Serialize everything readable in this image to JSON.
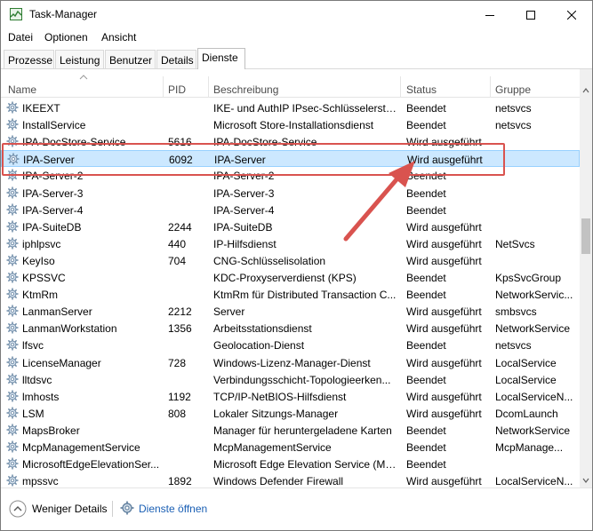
{
  "window": {
    "title": "Task-Manager"
  },
  "menu": [
    "Datei",
    "Optionen",
    "Ansicht"
  ],
  "tabs": [
    "Prozesse",
    "Leistung",
    "Benutzer",
    "Details",
    "Dienste"
  ],
  "active_tab": "Dienste",
  "columns": {
    "name": "Name",
    "pid": "PID",
    "description": "Beschreibung",
    "status": "Status",
    "group": "Gruppe"
  },
  "rows": [
    {
      "name": "IKEEXT",
      "pid": "",
      "description": "IKE- und AuthIP IPsec-Schlüsselerste...",
      "status": "Beendet",
      "group": "netsvcs"
    },
    {
      "name": "InstallService",
      "pid": "",
      "description": "Microsoft Store-Installationsdienst",
      "status": "Beendet",
      "group": "netsvcs"
    },
    {
      "name": "IPA-DocStore-Service",
      "pid": "5616",
      "description": "IPA-DocStore-Service",
      "status": "Wird ausgeführt",
      "group": ""
    },
    {
      "name": "IPA-Server",
      "pid": "6092",
      "description": "IPA-Server",
      "status": "Wird ausgeführt",
      "group": "",
      "selected": true
    },
    {
      "name": "IPA-Server-2",
      "pid": "",
      "description": "IPA-Server-2",
      "status": "Beendet",
      "group": ""
    },
    {
      "name": "IPA-Server-3",
      "pid": "",
      "description": "IPA-Server-3",
      "status": "Beendet",
      "group": ""
    },
    {
      "name": "IPA-Server-4",
      "pid": "",
      "description": "IPA-Server-4",
      "status": "Beendet",
      "group": ""
    },
    {
      "name": "IPA-SuiteDB",
      "pid": "2244",
      "description": "IPA-SuiteDB",
      "status": "Wird ausgeführt",
      "group": ""
    },
    {
      "name": "iphlpsvc",
      "pid": "440",
      "description": "IP-Hilfsdienst",
      "status": "Wird ausgeführt",
      "group": "NetSvcs"
    },
    {
      "name": "KeyIso",
      "pid": "704",
      "description": "CNG-Schlüsselisolation",
      "status": "Wird ausgeführt",
      "group": ""
    },
    {
      "name": "KPSSVC",
      "pid": "",
      "description": "KDC-Proxyserverdienst (KPS)",
      "status": "Beendet",
      "group": "KpsSvcGroup"
    },
    {
      "name": "KtmRm",
      "pid": "",
      "description": "KtmRm für Distributed Transaction C...",
      "status": "Beendet",
      "group": "NetworkServic..."
    },
    {
      "name": "LanmanServer",
      "pid": "2212",
      "description": "Server",
      "status": "Wird ausgeführt",
      "group": "smbsvcs"
    },
    {
      "name": "LanmanWorkstation",
      "pid": "1356",
      "description": "Arbeitsstationsdienst",
      "status": "Wird ausgeführt",
      "group": "NetworkService"
    },
    {
      "name": "lfsvc",
      "pid": "",
      "description": "Geolocation-Dienst",
      "status": "Beendet",
      "group": "netsvcs"
    },
    {
      "name": "LicenseManager",
      "pid": "728",
      "description": "Windows-Lizenz-Manager-Dienst",
      "status": "Wird ausgeführt",
      "group": "LocalService"
    },
    {
      "name": "lltdsvc",
      "pid": "",
      "description": "Verbindungsschicht-Topologieerken...",
      "status": "Beendet",
      "group": "LocalService"
    },
    {
      "name": "lmhosts",
      "pid": "1192",
      "description": "TCP/IP-NetBIOS-Hilfsdienst",
      "status": "Wird ausgeführt",
      "group": "LocalServiceN..."
    },
    {
      "name": "LSM",
      "pid": "808",
      "description": "Lokaler Sitzungs-Manager",
      "status": "Wird ausgeführt",
      "group": "DcomLaunch"
    },
    {
      "name": "MapsBroker",
      "pid": "",
      "description": "Manager für heruntergeladene Karten",
      "status": "Beendet",
      "group": "NetworkService"
    },
    {
      "name": "McpManagementService",
      "pid": "",
      "description": "McpManagementService",
      "status": "Beendet",
      "group": "McpManage..."
    },
    {
      "name": "MicrosoftEdgeElevationSer...",
      "pid": "",
      "description": "Microsoft Edge Elevation Service (Mi...",
      "status": "Beendet",
      "group": ""
    },
    {
      "name": "mpssvc",
      "pid": "1892",
      "description": "Windows Defender Firewall",
      "status": "Wird ausgeführt",
      "group": "LocalServiceN..."
    }
  ],
  "footer": {
    "less_details": "Weniger Details",
    "open_services": "Dienste öffnen"
  },
  "colors": {
    "selection_bg": "#cce8ff",
    "selection_border": "#99d1ff",
    "annotation": "#d9534f",
    "link": "#1a5fb4"
  }
}
